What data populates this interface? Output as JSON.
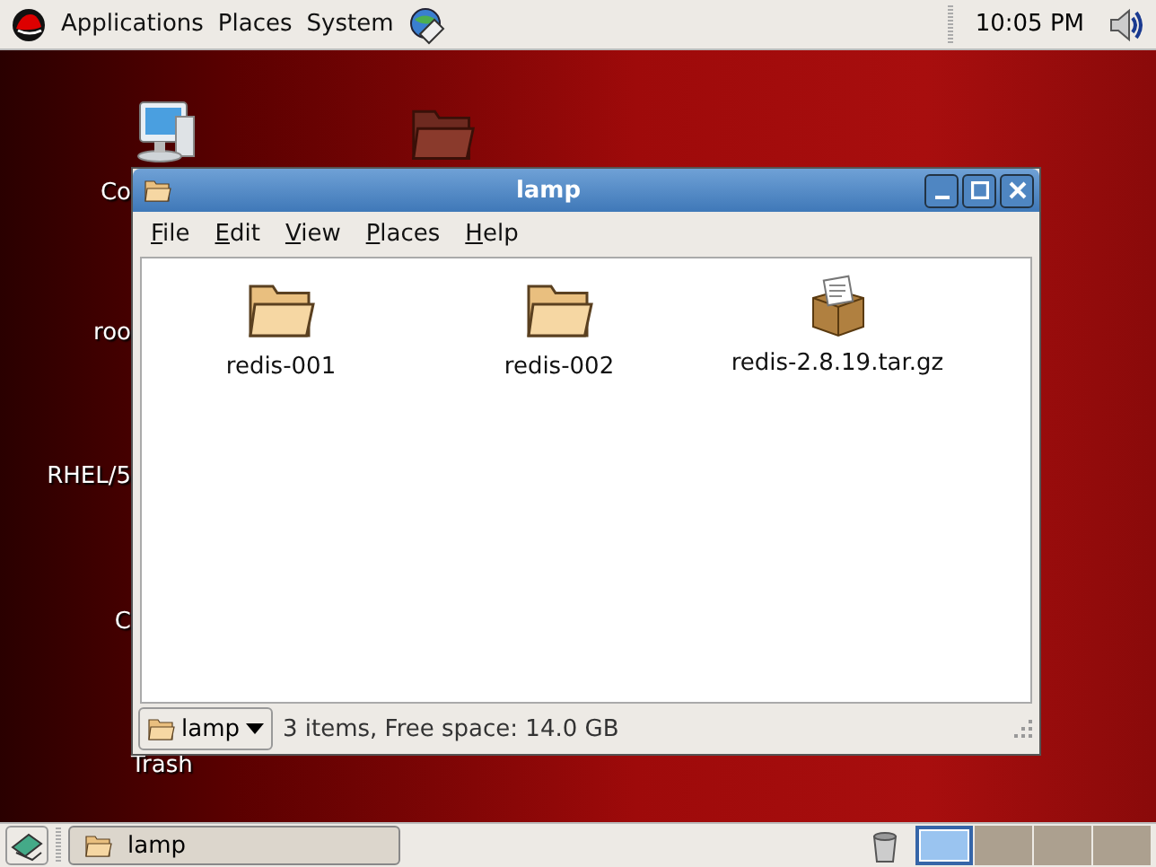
{
  "top_panel": {
    "menus": [
      "Applications",
      "Places",
      "System"
    ],
    "clock": "10:05 PM"
  },
  "desktop": {
    "icons": [
      {
        "kind": "computer",
        "label": "Co"
      },
      {
        "kind": "folder"
      },
      {
        "kind": "label",
        "label": "roo"
      },
      {
        "kind": "label",
        "label": "RHEL/5"
      },
      {
        "kind": "label",
        "label": "C"
      },
      {
        "kind": "label",
        "label": "Trash"
      }
    ]
  },
  "window": {
    "title": "lamp",
    "menu": [
      "File",
      "Edit",
      "View",
      "Places",
      "Help"
    ],
    "items": [
      {
        "kind": "folder",
        "name": "redis-001"
      },
      {
        "kind": "folder",
        "name": "redis-002"
      },
      {
        "kind": "package",
        "name": "redis-2.8.19.tar.gz"
      }
    ],
    "location": "lamp",
    "status": "3 items, Free space: 14.0 GB"
  },
  "bottom_panel": {
    "tasks": [
      {
        "title": "lamp"
      }
    ],
    "workspaces": [
      {
        "selected": true
      },
      {
        "selected": false
      },
      {
        "selected": false
      },
      {
        "selected": false
      }
    ]
  }
}
